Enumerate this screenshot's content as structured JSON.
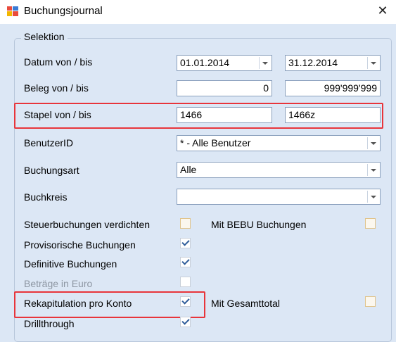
{
  "window": {
    "title": "Buchungsjournal",
    "close_glyph": "✕"
  },
  "group": {
    "legend": "Selektion"
  },
  "rows": {
    "datum": {
      "label": "Datum von / bis",
      "from": "01.01.2014",
      "to": "31.12.2014"
    },
    "beleg": {
      "label": "Beleg von / bis",
      "from": "0",
      "to": "999'999'999"
    },
    "stapel": {
      "label": "Stapel von / bis",
      "from": "1466",
      "to": "1466z"
    },
    "benutzer": {
      "label": "BenutzerID",
      "value": "* - Alle Benutzer"
    },
    "buchungsart": {
      "label": "Buchungsart",
      "value": "Alle"
    },
    "buchkreis": {
      "label": "Buchkreis",
      "value": ""
    }
  },
  "options": {
    "steuer": {
      "label": "Steuerbuchungen verdichten",
      "checked": false
    },
    "bebu": {
      "label": "Mit BEBU Buchungen",
      "checked": false
    },
    "provisorisch": {
      "label": "Provisorische Buchungen",
      "checked": true
    },
    "definitiv": {
      "label": "Definitive Buchungen",
      "checked": true
    },
    "euro": {
      "label": "Beträge in Euro",
      "checked": false,
      "disabled": true
    },
    "rekap": {
      "label": "Rekapitulation pro Konto",
      "checked": true
    },
    "gesamttotal": {
      "label": "Mit Gesamttotal",
      "checked": false
    },
    "drill": {
      "label": "Drillthrough",
      "checked": true
    }
  },
  "colors": {
    "highlight": "#e8353b",
    "background": "#dce7f5"
  },
  "icons": {
    "app": "journal-app-icon",
    "dropdown": "chevron-down-icon",
    "close": "close-icon"
  }
}
